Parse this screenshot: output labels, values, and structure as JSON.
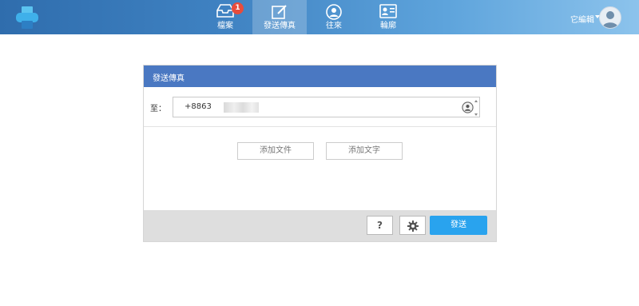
{
  "topbar": {
    "nav": [
      {
        "label": "檔案",
        "icon": "inbox-icon",
        "badge": "1",
        "active": false
      },
      {
        "label": "發送傳真",
        "icon": "compose-icon",
        "active": true
      },
      {
        "label": "往來",
        "icon": "person-icon",
        "active": false
      },
      {
        "label": "輪廓",
        "icon": "profile-card-icon",
        "active": false
      }
    ],
    "user": {
      "name": "它編輯"
    }
  },
  "dialog": {
    "title": "發送傳真",
    "to_label": "至：",
    "to_value": "+8863",
    "add_file_label": "添加文件",
    "add_text_label": "添加文字",
    "help_label": "?",
    "send_label": "發送"
  },
  "colors": {
    "header_blue": "#4a78c2",
    "send_blue": "#29a3ee",
    "badge_red": "#e74c3c"
  }
}
